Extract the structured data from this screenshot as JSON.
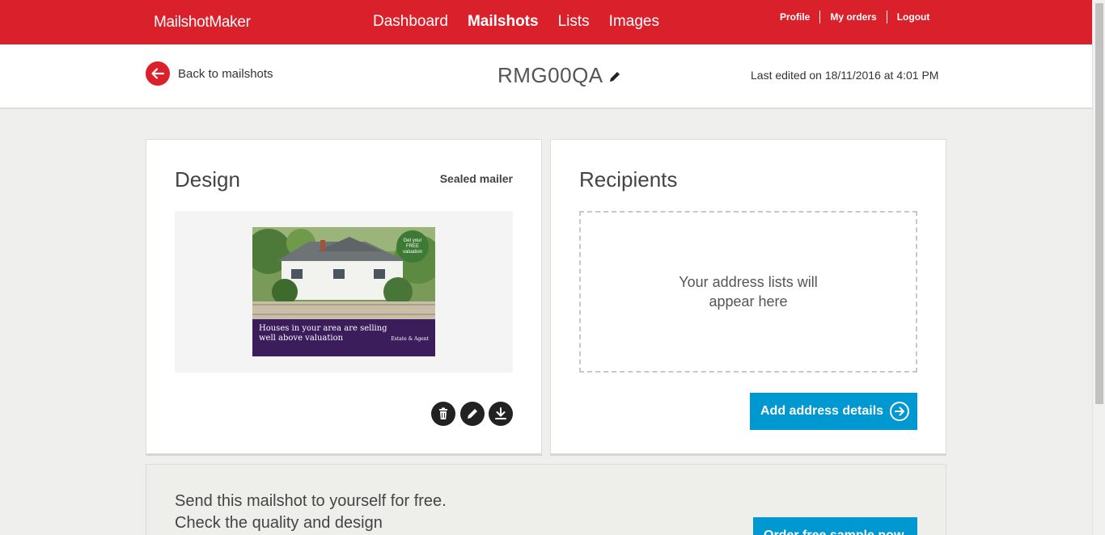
{
  "app": {
    "brand": "MailshotMaker"
  },
  "nav": {
    "items": [
      {
        "label": "Dashboard"
      },
      {
        "label": "Mailshots"
      },
      {
        "label": "Lists"
      },
      {
        "label": "Images"
      }
    ],
    "user_links": {
      "profile": "Profile",
      "orders": "My orders",
      "logout": "Logout"
    }
  },
  "header": {
    "back_label": "Back to mailshots",
    "title": "RMG00QA",
    "last_edited": "Last edited on 18/11/2016 at 4:01 PM"
  },
  "design": {
    "title": "Design",
    "tag": "Sealed mailer",
    "preview": {
      "headline": "Houses in your area are selling well above valuation",
      "badge": "Get your FREE valuation",
      "logo": "Estate & Agent"
    }
  },
  "recipients": {
    "title": "Recipients",
    "empty_text": "Your address lists will appear here",
    "button_label": "Add address details"
  },
  "sample": {
    "text": "Send this mailshot to yourself for free. Check the quality and design",
    "button_label": "Order free sample now"
  },
  "colors": {
    "brand_red": "#da202a",
    "accent_blue": "#0098d0",
    "mailer_purple": "#3b1d5c"
  },
  "icons": [
    "back-arrow-icon",
    "pencil-icon",
    "trash-icon",
    "download-icon",
    "arrow-right-icon"
  ]
}
